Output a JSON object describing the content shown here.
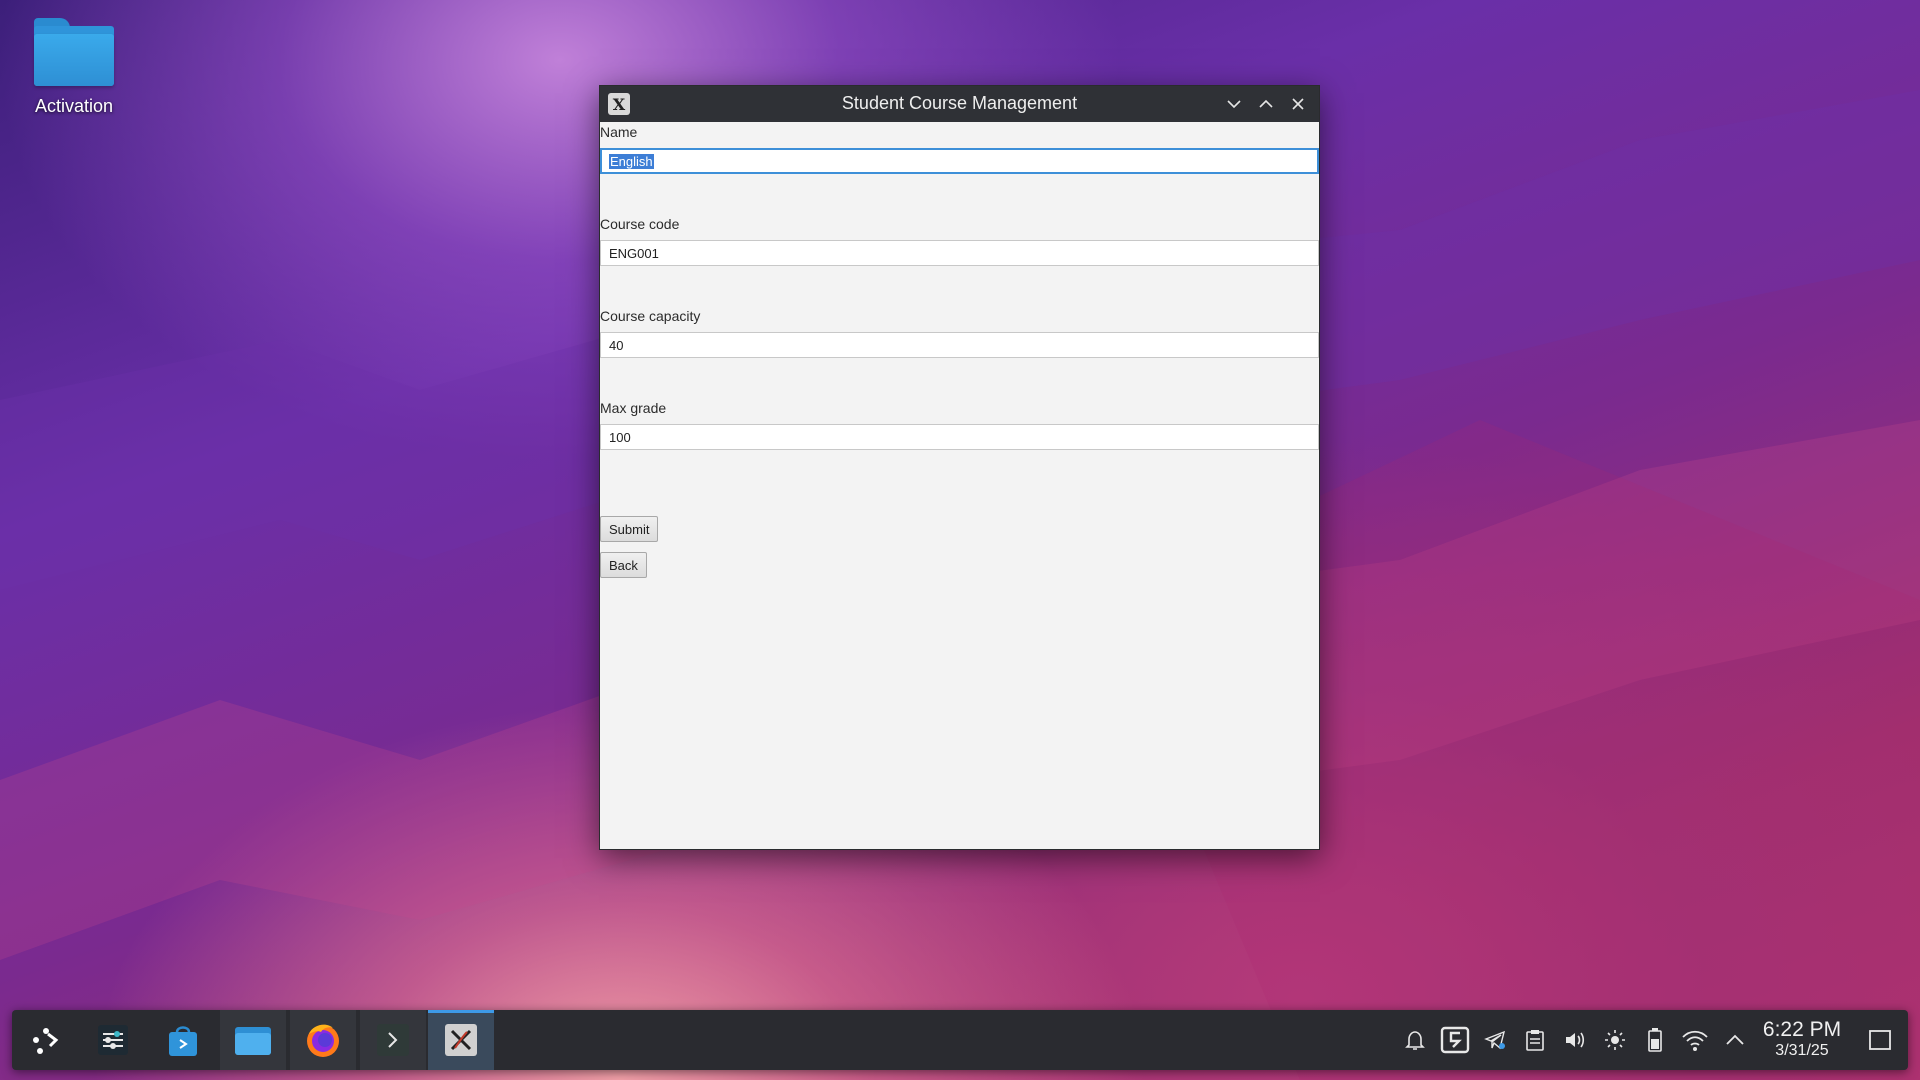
{
  "desktop": {
    "icons": [
      {
        "label": "Activation",
        "icon": "folder-icon"
      }
    ]
  },
  "window": {
    "title": "Student Course Management",
    "controls": [
      "minimize-icon",
      "maximize-icon",
      "close-icon"
    ],
    "form": {
      "fields": [
        {
          "label": "Name",
          "value": "English",
          "focused": true,
          "selected": true
        },
        {
          "label": "Course code",
          "value": "ENG001"
        },
        {
          "label": "Course capacity",
          "value": "40"
        },
        {
          "label": "Max grade",
          "value": "100"
        }
      ],
      "buttons": {
        "submit": "Submit",
        "back": "Back"
      }
    }
  },
  "taskbar": {
    "apps": [
      "app-launcher-icon",
      "system-settings-icon",
      "discover-store-icon",
      "file-manager-icon",
      "firefox-icon",
      "terminal-icon",
      "java-app-icon"
    ],
    "active_app": "java-app-icon",
    "tray": [
      "notifications-icon",
      "kde-connect-icon",
      "telegram-icon",
      "clipboard-icon",
      "volume-icon",
      "brightness-icon",
      "battery-icon",
      "wifi-icon",
      "tray-expand-icon"
    ],
    "clock": {
      "time": "6:22 PM",
      "date": "3/31/25"
    },
    "show_desktop": "show-desktop-icon"
  },
  "colors": {
    "accent": "#3d8fd8",
    "titlebar": "#2f3136",
    "taskbar": "#2a2b30",
    "window_bg": "#f3f3f3"
  }
}
